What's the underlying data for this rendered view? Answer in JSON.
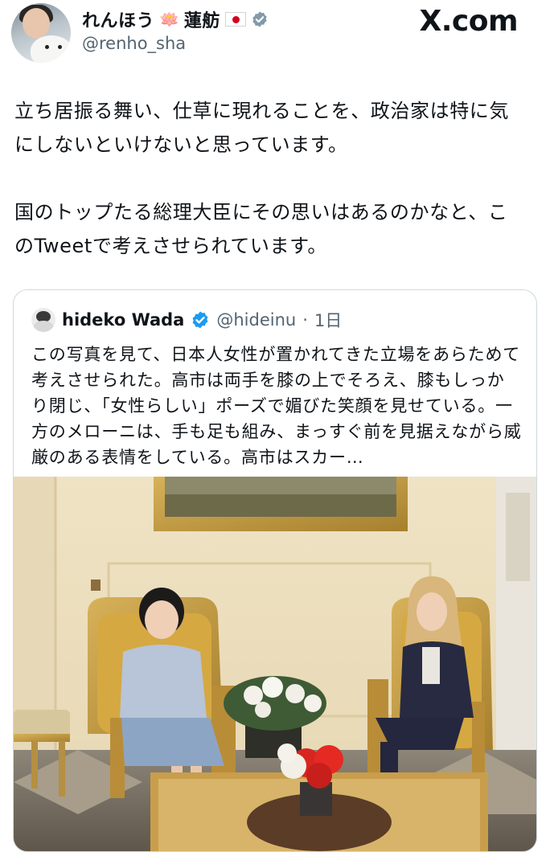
{
  "header": {
    "display_name": "れんほう",
    "display_name_2": "蓮舫",
    "lotus_emoji": "🪷",
    "flag": "japan-flag",
    "handle": "@renho_sha",
    "site_logo": "X.com",
    "verified_color": "#829aab"
  },
  "tweet": {
    "text": "立ち居振る舞い、仕草に現れることを、政治家は特に気\nにしないといけないと思っています。\n\n国のトップたる総理大臣にその思いはあるのかなと、こ\nのTweetで考えさせられています。"
  },
  "quote": {
    "author_name": "hideko Wada",
    "author_handle": "@hideinu",
    "separator": "·",
    "time": "1日",
    "verified_color": "#1d9bf0",
    "text": "この写真を見て、日本人女性が置かれてきた立場をあらためて考えさせられた。高市は両手を膝の上でそろえ、膝もしっかり閉じ、「女性らしい」ポーズで媚びた笑顔を見せている。一方のメローニは、手も足も組み、まっすぐ前を見据えながら威厳のある表情をしている。高市はスカー…",
    "photo": "photo-two-women-seated-in-golden-chairs"
  },
  "colors": {
    "text": "#0f1419",
    "secondary": "#536471",
    "border": "#cfd9de"
  }
}
